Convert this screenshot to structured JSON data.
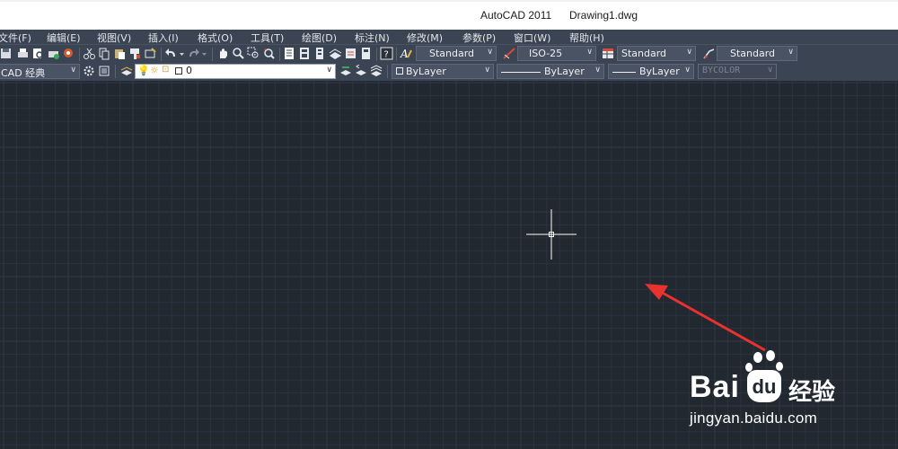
{
  "window": {
    "app_title": "AutoCAD 2011",
    "document_title": "Drawing1.dwg"
  },
  "menu": {
    "items": [
      "文件(F)",
      "编辑(E)",
      "视图(V)",
      "插入(I)",
      "格式(O)",
      "工具(T)",
      "绘图(D)",
      "标注(N)",
      "修改(M)",
      "参数(P)",
      "窗口(W)",
      "帮助(H)"
    ]
  },
  "styles_toolbar": {
    "text_style": "Standard",
    "dim_style": "ISO-25",
    "table_style": "Standard",
    "multileader_style": "Standard"
  },
  "layers_toolbar": {
    "workspace": "CAD 经典",
    "current_layer": "0"
  },
  "properties_toolbar": {
    "color": "ByLayer",
    "linetype": "ByLayer",
    "lineweight": "ByLayer",
    "plot_style": "BYCOLOR"
  },
  "watermark": {
    "brand": "Bai",
    "brand_cn": "经验",
    "url": "jingyan.baidu.com"
  },
  "colors": {
    "canvas": "#212830",
    "toolbar": "#3b4453",
    "arrow": "#e8322f",
    "crosshair": "#ffffff"
  }
}
